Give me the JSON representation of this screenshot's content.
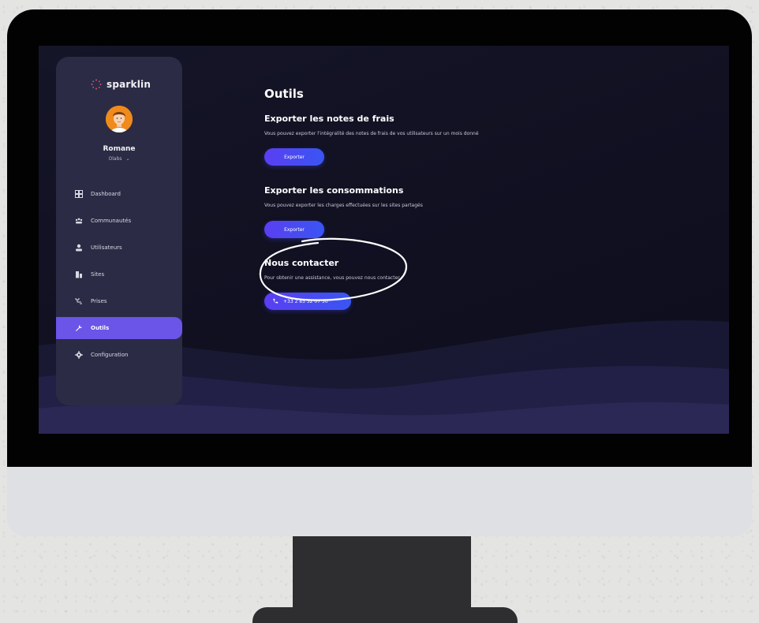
{
  "app": {
    "brand": "sparklin",
    "user": {
      "name": "Romane",
      "org": "Olabs"
    }
  },
  "sidebar": {
    "items": [
      {
        "label": "Dashboard",
        "icon": "dashboard-icon"
      },
      {
        "label": "Communautés",
        "icon": "communities-icon"
      },
      {
        "label": "Utilisateurs",
        "icon": "user-icon"
      },
      {
        "label": "Sites",
        "icon": "building-icon"
      },
      {
        "label": "Prises",
        "icon": "plug-icon"
      },
      {
        "label": "Outils",
        "icon": "wrench-icon",
        "active": true
      },
      {
        "label": "Configuration",
        "icon": "gear-icon"
      }
    ]
  },
  "main": {
    "title": "Outils",
    "sections": [
      {
        "title": "Exporter les notes de frais",
        "description": "Vous pouvez exporter l'intégralité des notes de frais de vos utilisateurs sur un mois donné",
        "button": "Exporter"
      },
      {
        "title": "Exporter les consommations",
        "description": "Vous pouvez exporter les charges effectuées sur les sites partagés",
        "button": "Exporter"
      },
      {
        "title": "Nous contacter",
        "description": "Pour obtenir une assistance, vous pouvez nous contacter",
        "button": "+33 2 85 52 07 50"
      }
    ]
  },
  "colors": {
    "accent": "#6b54e8",
    "button_gradient_start": "#5a3ff2",
    "button_gradient_end": "#3a55f3",
    "sidebar_bg": "#2b2b45",
    "screen_bg": "#121224"
  }
}
